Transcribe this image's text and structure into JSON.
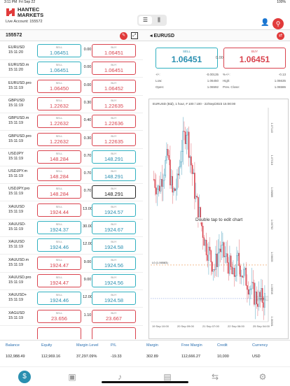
{
  "status": {
    "time": "3:11 PM",
    "date": "Fri Sep 22",
    "battery": "100%"
  },
  "header": {
    "brand_line1": "HANTEC",
    "brand_line2": "MARKETS",
    "account_label": "Live Account: 155572"
  },
  "toolbar": {
    "account_id": "155572",
    "symbol": "EURUSD"
  },
  "watchlist": [
    {
      "symbol": "EURUSD",
      "time": "15:11:20",
      "sell_label": "SELL",
      "sell": "1.06451",
      "sell_color": "up",
      "spread": "0.00",
      "buy_label": "BUY",
      "buy": "1.06451",
      "buy_color": "down"
    },
    {
      "symbol": "EURUSD.m",
      "time": "15:11:20",
      "sell_label": "SELL",
      "sell": "1.06451",
      "sell_color": "up",
      "spread": "0.00",
      "buy_label": "BUY",
      "buy": "1.06451",
      "buy_color": "down"
    },
    {
      "symbol": "EURUSD.pro",
      "time": "15:11:19",
      "sell_label": "SELL",
      "sell": "1.06450",
      "sell_color": "down",
      "spread": "0.00",
      "buy_label": "BUY",
      "buy": "1.06452",
      "buy_color": "down"
    },
    {
      "symbol": "GBPUSD",
      "time": "15:11:19",
      "sell_label": "SELL",
      "sell": "1.22632",
      "sell_color": "down",
      "spread": "0.30",
      "buy_label": "BUY",
      "buy": "1.22635",
      "buy_color": "down"
    },
    {
      "symbol": "GBPUSD.m",
      "time": "15:11:19",
      "sell_label": "SELL",
      "sell": "1.22632",
      "sell_color": "down",
      "spread": "0.40",
      "buy_label": "BUY",
      "buy": "1.22636",
      "buy_color": "down"
    },
    {
      "symbol": "GBPUSD.pro",
      "time": "15:11:19",
      "sell_label": "SELL",
      "sell": "1.22632",
      "sell_color": "down",
      "spread": "0.30",
      "buy_label": "BUY",
      "buy": "1.22635",
      "buy_color": "down"
    },
    {
      "symbol": "USDJPY",
      "time": "15:11:19",
      "sell_label": "SELL",
      "sell": "148.284",
      "sell_color": "down",
      "spread": "0.70",
      "buy_label": "BUY",
      "buy": "148.291",
      "buy_color": "up"
    },
    {
      "symbol": "USDJPY.m",
      "time": "15:11:19",
      "sell_label": "SELL",
      "sell": "148.284",
      "sell_color": "down",
      "spread": "0.70",
      "buy_label": "BUY",
      "buy": "148.291",
      "buy_color": "up"
    },
    {
      "symbol": "USDJPY.pro",
      "time": "15:11:19",
      "sell_label": "SELL",
      "sell": "148.284",
      "sell_color": "down",
      "spread": "0.70",
      "buy_label": "BUY",
      "buy": "148.291",
      "buy_color": "neutral"
    },
    {
      "symbol": "XAUUSD",
      "time": "15:11:19",
      "sell_label": "SELL",
      "sell": "1924.44",
      "sell_color": "down",
      "spread": "13.00",
      "buy_label": "BUY",
      "buy": "1924.57",
      "buy_color": "up"
    },
    {
      "symbol": "XAUUSD-",
      "time": "15:11:19",
      "sell_label": "SELL",
      "sell": "1924.37",
      "sell_color": "up",
      "spread": "30.00",
      "buy_label": "BUY",
      "buy": "1924.67",
      "buy_color": "up"
    },
    {
      "symbol": "XAUUSD",
      "time": "15:11:19",
      "sell_label": "SELL",
      "sell": "1924.46",
      "sell_color": "up",
      "spread": "12.00",
      "buy_label": "BUY",
      "buy": "1924.58",
      "buy_color": "up"
    },
    {
      "symbol": "XAUUSD.m",
      "time": "15:11:19",
      "sell_label": "SELL",
      "sell": "1924.47",
      "sell_color": "down",
      "spread": "9.00",
      "buy_label": "BUY",
      "buy": "1924.56",
      "buy_color": "up"
    },
    {
      "symbol": "XAUUSD.pro",
      "time": "15:11:19",
      "sell_label": "SELL",
      "sell": "1924.47",
      "sell_color": "down",
      "spread": "9.00",
      "buy_label": "BUY",
      "buy": "1924.56",
      "buy_color": "up"
    },
    {
      "symbol": "XAUUSD+",
      "time": "15:11:19",
      "sell_label": "SELL",
      "sell": "1924.46",
      "sell_color": "up",
      "spread": "12.00",
      "buy_label": "BUY",
      "buy": "1924.58",
      "buy_color": "up"
    },
    {
      "symbol": "XAGUSD",
      "time": "15:11:19",
      "sell_label": "SELL",
      "sell": "23.656",
      "sell_color": "down",
      "spread": "1.10",
      "buy_label": "BUY",
      "buy": "23.667",
      "buy_color": "down"
    },
    {
      "symbol": "",
      "time": "",
      "sell_label": "",
      "sell": "",
      "sell_color": "down",
      "spread": "",
      "buy_label": "",
      "buy": "",
      "buy_color": "down"
    }
  ],
  "detail": {
    "sell_label": "SELL",
    "sell": "1.06451",
    "change": "0.00",
    "buy_label": "BUY",
    "buy": "1.06451",
    "stats": [
      {
        "k": "+/-:",
        "v": "-0.00135"
      },
      {
        "k": "%+/-:",
        "v": "-0.13"
      },
      {
        "k": "Low:",
        "v": "1.06450"
      },
      {
        "k": "High:",
        "v": "1.06635"
      },
      {
        "k": "Open:",
        "v": "1.06592"
      },
      {
        "k": "Prev. Close:",
        "v": "1.06586"
      }
    ]
  },
  "chart": {
    "title": "EURUSD (Bid), 1 hour, # 100 / 100 - 22/Sep/2023 15:00:00",
    "hint": "Double tap to edit chart",
    "level_label": "L0 (1.06583)",
    "price_tag": "1.06451",
    "y_ticks": [
      "1.07143",
      "1.07016",
      "1.06889",
      "1.06762",
      "1.06635",
      "1.06508",
      "1.06381"
    ],
    "x_ticks": [
      "19 Sep 10:00",
      "20 Sep 09:00",
      "21 Sep 07:00",
      "22 Sep 06:00",
      "25 Sep 04:00"
    ]
  },
  "chart_data": {
    "type": "candlestick",
    "title": "EURUSD (Bid), 1 hour, # 100 / 100 - 22/Sep/2023 15:00:00",
    "x": [
      "19 Sep 10:00",
      "20 Sep 09:00",
      "21 Sep 07:00",
      "22 Sep 06:00",
      "25 Sep 04:00"
    ],
    "series": [
      {
        "values": [
          1.0692,
          1.0688,
          1.0695,
          1.0701,
          1.0686,
          1.069,
          1.0705,
          1.0712,
          1.0698,
          1.0684,
          1.0676,
          1.0667,
          1.0662,
          1.0657,
          1.0665,
          1.0662,
          1.0659,
          1.0653,
          1.066,
          1.0655,
          1.0652,
          1.0648,
          1.0645,
          1.0645
        ]
      }
    ],
    "level": 1.06583,
    "last": 1.06451
  },
  "footer": {
    "cols": [
      {
        "label": "Balance",
        "value": "102,988.49"
      },
      {
        "label": "Equity",
        "value": "112,969.16"
      },
      {
        "label": "Margin Level",
        "value": "37,297.09%"
      },
      {
        "label": "P/L",
        "value": "-19.33"
      },
      {
        "label": "Margin",
        "value": "302.89"
      },
      {
        "label": "Free Margin",
        "value": "112,666.27"
      },
      {
        "label": "Credit",
        "value": "10,000"
      },
      {
        "label": "Currency",
        "value": "USD"
      }
    ]
  },
  "colors": {
    "accent": "#e13b3b",
    "up": "#2fb0c0",
    "down": "#d9434e",
    "link": "#2a6fb0"
  }
}
